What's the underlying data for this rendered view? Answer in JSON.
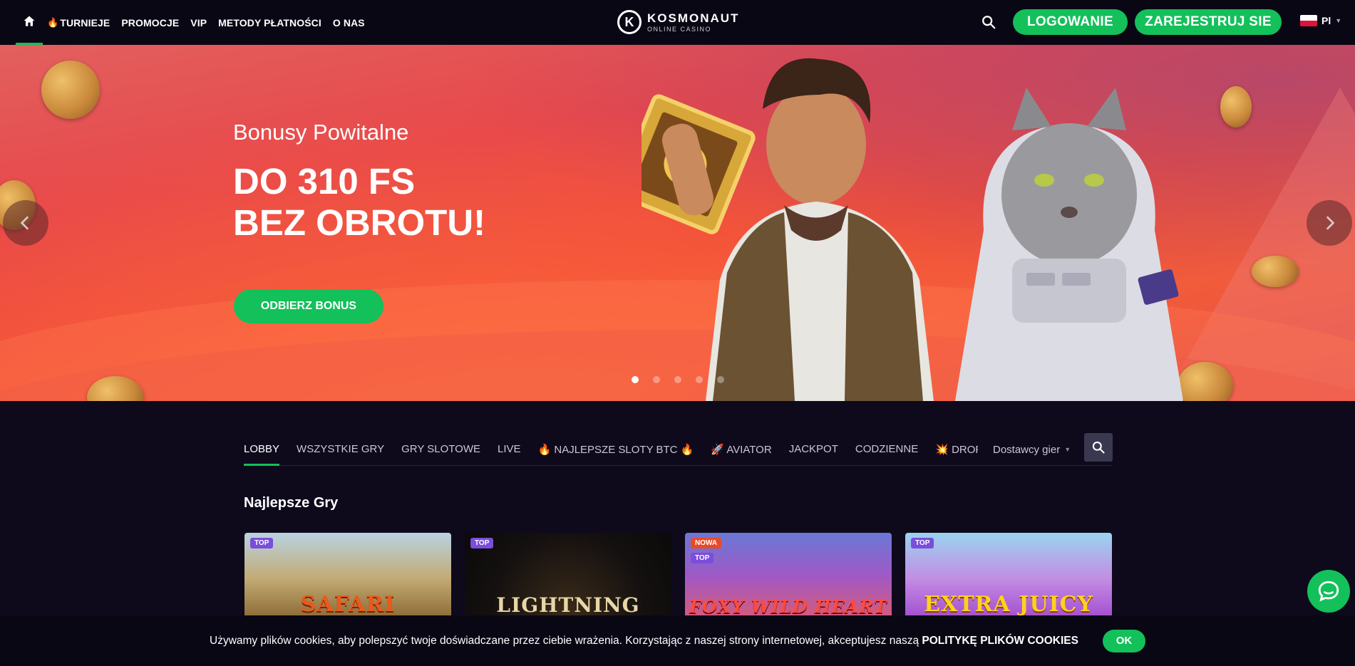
{
  "header": {
    "nav": [
      {
        "label": "TURNIEJE",
        "flame": "🔥"
      },
      {
        "label": "PROMOCJE"
      },
      {
        "label": "VIP"
      },
      {
        "label": "METODY PŁATNOŚCI"
      },
      {
        "label": "O NAS"
      }
    ],
    "logo_title": "KOSMONAUT",
    "logo_sub": "ONLINE CASINO",
    "login_label": "LOGOWANIE",
    "register_label": "ZAREJESTRUJ SIE",
    "lang": "Pl"
  },
  "hero": {
    "subtitle": "Bonusy Powitalne",
    "title_line1": "DO 310 FS",
    "title_line2": "BEZ OBROTU!",
    "cta": "ODBIERZ BONUS",
    "slides_count": 5,
    "active_slide": 1
  },
  "games_nav": {
    "tabs": [
      {
        "label": "LOBBY",
        "active": true
      },
      {
        "label": "WSZYSTKIE GRY"
      },
      {
        "label": "GRY SLOTOWE"
      },
      {
        "label": "LIVE"
      },
      {
        "label": "🔥 NAJLEPSZE SLOTY BTC 🔥"
      },
      {
        "label": "🚀 AVIATOR"
      },
      {
        "label": "JACKPOT"
      },
      {
        "label": "CODZIENNE"
      },
      {
        "label": "💥 DROPS & WINS"
      }
    ],
    "providers_label": "Dostawcy gier"
  },
  "section_title": "Najlepsze Gry",
  "games": [
    {
      "name": "SAFARI",
      "badges": [
        "TOP"
      ]
    },
    {
      "name": "LIGHTNING",
      "badges": [
        "TOP"
      ]
    },
    {
      "name": "FOXY WILD HEART",
      "badges": [
        "NOWA",
        "TOP"
      ]
    },
    {
      "name": "EXTRA JUICY",
      "badges": [
        "TOP"
      ]
    }
  ],
  "cookie": {
    "text": "Używamy plików cookies, aby polepszyć twoje doświadczane przez ciebie wrażenia. Korzystając z naszej strony internetowej, akceptujesz naszą",
    "link": "POLITYKĘ PLIKÓW COOKIES",
    "ok": "OK"
  },
  "colors": {
    "accent": "#13c05a",
    "background": "#0e0a1c",
    "header": "#0a0714"
  }
}
